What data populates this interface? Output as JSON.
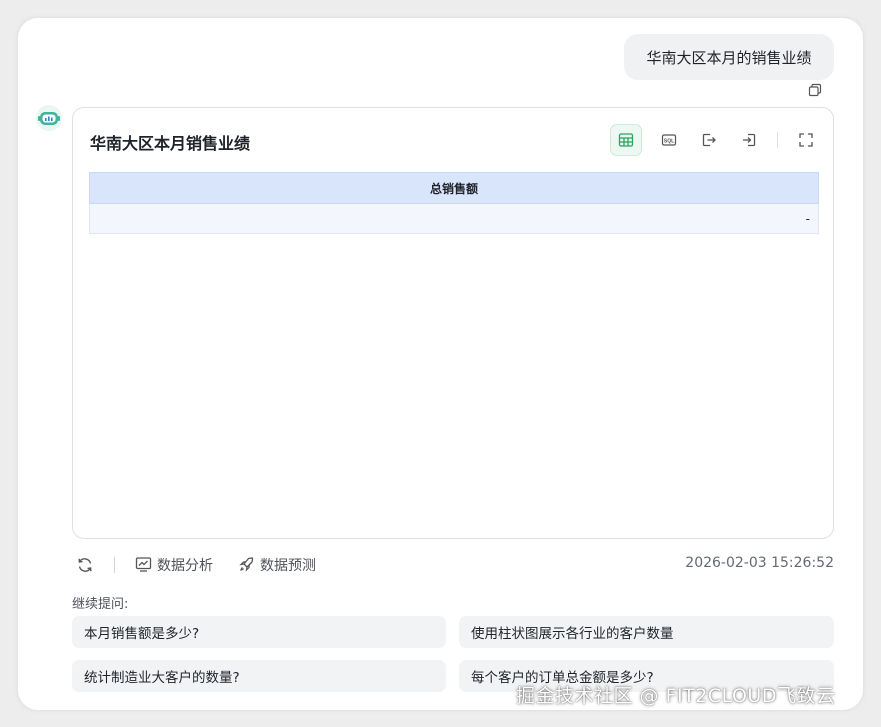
{
  "user_message": "华南大区本月的销售业绩",
  "result_card": {
    "title": "华南大区本月销售业绩",
    "table": {
      "headers": [
        "总销售额"
      ],
      "rows": [
        [
          "-"
        ]
      ]
    }
  },
  "actions": {
    "analysis_label": "数据分析",
    "predict_label": "数据预测",
    "timestamp": "2026-02-03 15:26:52"
  },
  "followup": {
    "label": "继续提问:",
    "suggestions": [
      "本月销售额是多少?",
      "使用柱状图展示各行业的客户数量",
      "统计制造业大客户的数量?",
      "每个客户的订单总金额是多少?"
    ]
  },
  "watermark": "掘金技术社区 @ FIT2CLOUD飞致云",
  "colors": {
    "accent_green": "#2aa460",
    "table_header_bg": "#d9e5fb",
    "table_row_bg": "#f4f6fd"
  }
}
